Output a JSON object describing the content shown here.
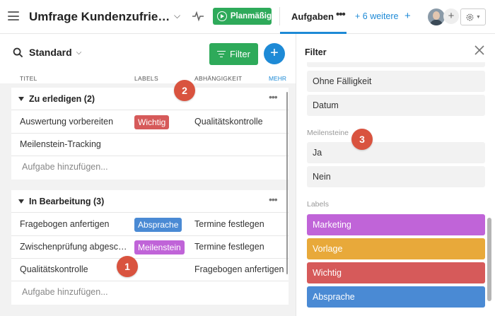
{
  "topbar": {
    "project_title": "Umfrage Kundenzufriede…",
    "status_label": "Planmäßig",
    "active_tab": "Aufgaben",
    "more_tabs": "+ 6 weitere",
    "add_tab": "+",
    "avatar_add": "+"
  },
  "list": {
    "view_name": "Standard",
    "filter_label": "Filter",
    "add_label": "+",
    "columns": {
      "title": "TITEL",
      "labels": "LABELS",
      "dependency": "ABHÄNGIGKEIT",
      "more": "MEHR"
    },
    "groups": [
      {
        "title": "Zu erledigen (2)",
        "menu": "•••",
        "rows": [
          {
            "task": "Auswertung vorbereiten",
            "label": "Wichtig",
            "label_color": "#d65a5a",
            "dependency": "Qualitätskontrolle"
          },
          {
            "task": "Meilenstein-Tracking",
            "label": "",
            "label_color": "",
            "dependency": ""
          }
        ],
        "add_task": "Aufgabe hinzufügen..."
      },
      {
        "title": "In Bearbeitung (3)",
        "menu": "•••",
        "rows": [
          {
            "task": "Fragebogen anfertigen",
            "label": "Absprache",
            "label_color": "#4a8ad4",
            "dependency": "Termine festlegen"
          },
          {
            "task": "Zwischenprüfung abgesc…",
            "label": "Meilenstein",
            "label_color": "#c064d8",
            "dependency": "Termine festlegen"
          },
          {
            "task": "Qualitätskontrolle",
            "label": "",
            "label_color": "",
            "dependency": "Fragebogen anfertigen"
          }
        ],
        "add_task": "Aufgabe hinzufügen..."
      }
    ]
  },
  "filter_panel": {
    "title": "Filter",
    "due_options": [
      "Ohne Fälligkeit",
      "Datum"
    ],
    "milestones_label": "Meilensteine",
    "milestone_options": [
      "Ja",
      "Nein"
    ],
    "labels_label": "Labels",
    "labels": [
      {
        "name": "Marketing",
        "color": "#c064d8"
      },
      {
        "name": "Vorlage",
        "color": "#e8a93a"
      },
      {
        "name": "Wichtig",
        "color": "#d65a5a"
      },
      {
        "name": "Absprache",
        "color": "#4a8ad4"
      }
    ]
  },
  "markers": [
    "1",
    "2",
    "3"
  ],
  "colors": {
    "green": "#2eaa5a",
    "blue": "#1e8ad6",
    "marker": "#d9533f"
  }
}
